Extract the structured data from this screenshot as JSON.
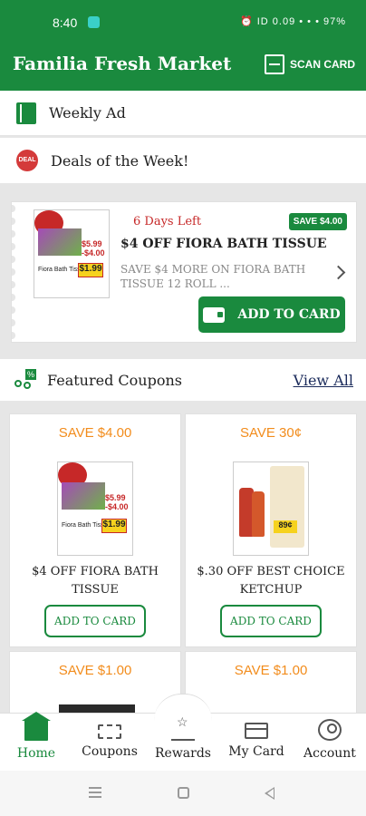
{
  "status_bar": {
    "time": "8:40",
    "right_text": "⏰ ID 0.09 • • • 97%"
  },
  "app": {
    "title": "Familia Fresh Market",
    "scan_card_label": "SCAN CARD"
  },
  "menu": {
    "weekly_ad_label": "Weekly Ad",
    "deals_label": "Deals of the Week!",
    "deals_icon_text": "DEAL"
  },
  "deal": {
    "days_left": "6 Days Left",
    "save_badge": "SAVE $4.00",
    "title": "$4 OFF FIORA BATH TISSUE",
    "description": "SAVE $4 MORE ON FIORA BATH TISSUE 12 ROLL ...",
    "add_to_card_label": "ADD TO CARD",
    "product": {
      "price_line1": "$5.99",
      "price_line2": "-$4.00",
      "final_price": "$1.99",
      "product_name": "Fiora Bath Tissue"
    }
  },
  "featured": {
    "label": "Featured Coupons",
    "view_all": "View All"
  },
  "coupons": [
    {
      "save": "SAVE $4.00",
      "title": "$4 OFF FIORA BATH TISSUE",
      "button": "ADD TO CARD"
    },
    {
      "save": "SAVE 30¢",
      "title": "$.30 OFF BEST CHOICE KETCHUP",
      "button": "ADD TO CARD",
      "price": "89¢"
    },
    {
      "save": "SAVE $1.00"
    },
    {
      "save": "SAVE $1.00"
    }
  ],
  "bottom_nav": {
    "home": "Home",
    "coupons": "Coupons",
    "rewards": "Rewards",
    "my_card": "My Card",
    "account": "Account"
  },
  "colors": {
    "brand_green": "#1a8a3e",
    "save_orange": "#f28c1c",
    "days_left_red": "#c62828"
  }
}
